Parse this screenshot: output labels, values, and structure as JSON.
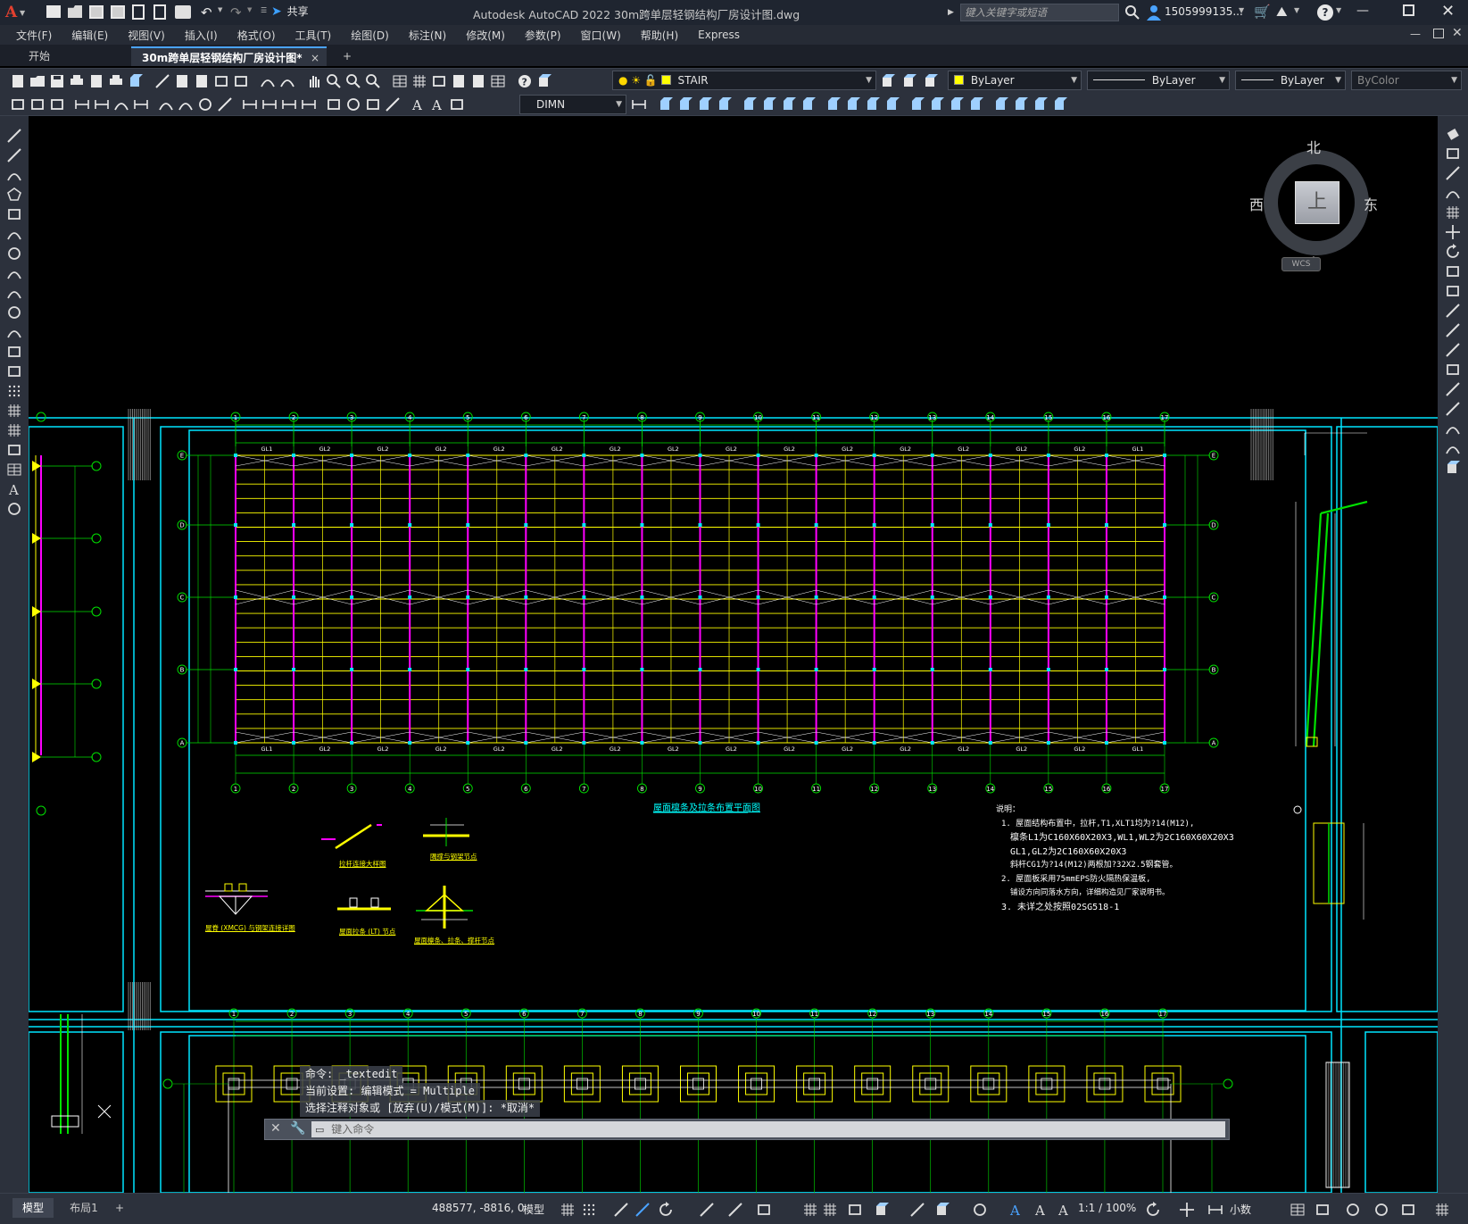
{
  "app": {
    "title": "Autodesk AutoCAD 2022    30m跨单层轻钢结构厂房设计图.dwg",
    "logo_letter": "A",
    "share_label": "共享",
    "search_placeholder": "键入关键字或短语",
    "user_name": "1505999135...",
    "accent_color": "#e2402f"
  },
  "menu": {
    "items": [
      "文件(F)",
      "编辑(E)",
      "视图(V)",
      "插入(I)",
      "格式(O)",
      "工具(T)",
      "绘图(D)",
      "标注(N)",
      "修改(M)",
      "参数(P)",
      "窗口(W)",
      "帮助(H)",
      "Express"
    ]
  },
  "tabs": {
    "start": "开始",
    "active": "30m跨单层轻钢结构厂房设计图*",
    "close": "×",
    "add": "+"
  },
  "toolbar": {
    "layer_name": "STAIR",
    "color_value": "ByLayer",
    "linetype_value": "ByLayer",
    "lineweight_value": "ByLayer",
    "plotstyle_value": "ByColor",
    "dimstyle_value": "DIMN"
  },
  "viewcube": {
    "north": "北",
    "south": "南",
    "east": "东",
    "west": "西",
    "face": "上",
    "wcs": "WCS"
  },
  "drawing": {
    "plan_title": "屋面檩条及拉条布置平面图",
    "notes_title": "说明：",
    "notes": [
      "1. 屋面结构布置中，拉杆,T1,XLT1均为?14(M12),",
      "檩条L1为C160X60X20X3,WL1,WL2为2C160X60X20X3",
      "GL1,GL2为2C160X60X20X3",
      "斜杆CG1为?14(M12)两根加?32X2.5钢套管。",
      "2. 屋面板采用75mmEPS防火隔热保温板,",
      "铺设方向同落水方向，详细构造见厂家说明书。",
      "3. 未详之处按照02SG518-1"
    ],
    "column_numbers": [
      "1",
      "2",
      "3",
      "4",
      "5",
      "6",
      "7",
      "8",
      "9",
      "10",
      "11",
      "12",
      "13",
      "14",
      "15",
      "16",
      "17"
    ],
    "row_letters": [
      "E",
      "D",
      "C",
      "B",
      "A"
    ],
    "beam_labels": [
      "GL1",
      "GL2",
      "GL2",
      "GL2",
      "GL2",
      "GL2",
      "GL2",
      "GL2",
      "GL2",
      "GL2",
      "GL2",
      "GL2",
      "GL2",
      "GL2",
      "GL2",
      "GL1"
    ],
    "detail_captions": [
      "屋脊 (XMCG) 与钢架连接详图",
      "拉杆连接大样图",
      "隅撑与钢架节点",
      "屋面拉条 (LT) 节点",
      "屋面檩条、拉条、撑杆节点"
    ],
    "colors": {
      "grid_green": "#00e000",
      "beam_yellow": "#ffff00",
      "rafter_magenta": "#ff00ff",
      "frame_cyan": "#00e5ff",
      "text_white": "#ffffff",
      "title_cyan": "#00ffff"
    }
  },
  "command": {
    "line1": "命令: _textedit",
    "line2": "当前设置: 编辑模式 = Multiple",
    "line3": "选择注释对象或 [放弃(U)/模式(M)]: *取消*",
    "input_placeholder": "键入命令"
  },
  "status": {
    "model_tab": "模型",
    "layout_tab": "布局1",
    "add_tab": "+",
    "coords": "488577, -8816, 0",
    "mode": "模型",
    "scale": "1:1 / 100%",
    "units": "小数"
  }
}
